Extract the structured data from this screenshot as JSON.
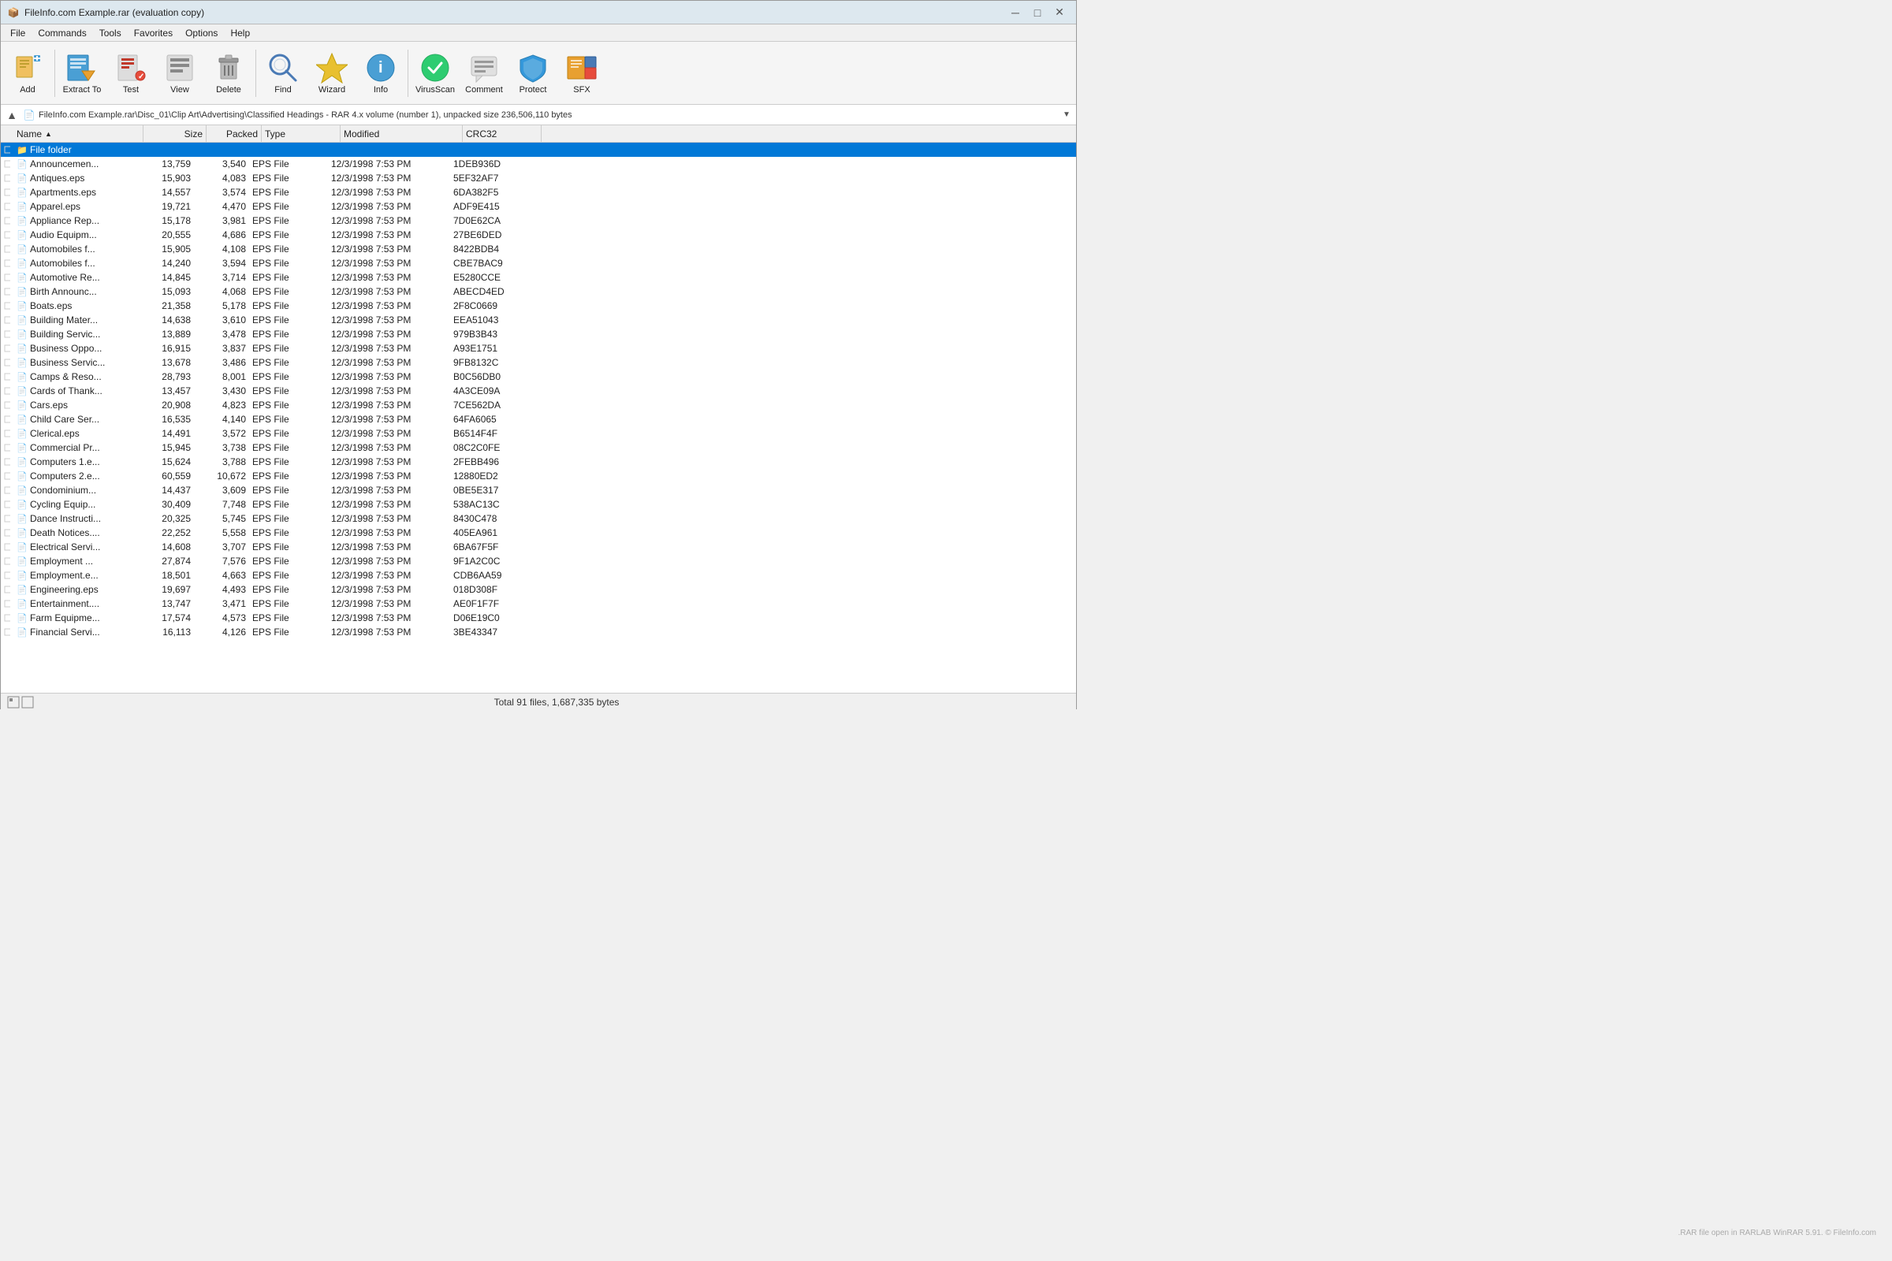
{
  "titleBar": {
    "icon": "📦",
    "title": "FileInfo.com Example.rar (evaluation copy)",
    "minBtn": "─",
    "maxBtn": "□",
    "closeBtn": "✕"
  },
  "menuBar": {
    "items": [
      "File",
      "Commands",
      "Tools",
      "Favorites",
      "Options",
      "Help"
    ]
  },
  "toolbar": {
    "buttons": [
      {
        "id": "add",
        "label": "Add",
        "icon": "add"
      },
      {
        "id": "extract-to",
        "label": "Extract To",
        "icon": "extract"
      },
      {
        "id": "test",
        "label": "Test",
        "icon": "test"
      },
      {
        "id": "view",
        "label": "View",
        "icon": "view"
      },
      {
        "id": "delete",
        "label": "Delete",
        "icon": "delete"
      },
      {
        "id": "find",
        "label": "Find",
        "icon": "find"
      },
      {
        "id": "wizard",
        "label": "Wizard",
        "icon": "wizard"
      },
      {
        "id": "info",
        "label": "Info",
        "icon": "info"
      },
      {
        "id": "virusscan",
        "label": "VirusScan",
        "icon": "virusscan"
      },
      {
        "id": "comment",
        "label": "Comment",
        "icon": "comment"
      },
      {
        "id": "protect",
        "label": "Protect",
        "icon": "protect"
      },
      {
        "id": "sfx",
        "label": "SFX",
        "icon": "sfx"
      }
    ]
  },
  "addressBar": {
    "path": "FileInfo.com Example.rar\\Disc_01\\Clip Art\\Advertising\\Classified Headings - RAR 4.x volume (number 1), unpacked size 236,506,110 bytes"
  },
  "columns": [
    {
      "id": "name",
      "label": "Name",
      "sortArrow": "▲"
    },
    {
      "id": "size",
      "label": "Size"
    },
    {
      "id": "packed",
      "label": "Packed"
    },
    {
      "id": "type",
      "label": "Type"
    },
    {
      "id": "modified",
      "label": "Modified"
    },
    {
      "id": "crc",
      "label": "CRC32"
    }
  ],
  "folderRow": {
    "name": "File folder",
    "selected": true
  },
  "files": [
    {
      "name": "Announcemen...",
      "size": "13,759",
      "packed": "3,540",
      "type": "EPS File",
      "modified": "12/3/1998 7:53 PM",
      "crc": "1DEB936D"
    },
    {
      "name": "Antiques.eps",
      "size": "15,903",
      "packed": "4,083",
      "type": "EPS File",
      "modified": "12/3/1998 7:53 PM",
      "crc": "5EF32AF7"
    },
    {
      "name": "Apartments.eps",
      "size": "14,557",
      "packed": "3,574",
      "type": "EPS File",
      "modified": "12/3/1998 7:53 PM",
      "crc": "6DA382F5"
    },
    {
      "name": "Apparel.eps",
      "size": "19,721",
      "packed": "4,470",
      "type": "EPS File",
      "modified": "12/3/1998 7:53 PM",
      "crc": "ADF9E415"
    },
    {
      "name": "Appliance Rep...",
      "size": "15,178",
      "packed": "3,981",
      "type": "EPS File",
      "modified": "12/3/1998 7:53 PM",
      "crc": "7D0E62CA"
    },
    {
      "name": "Audio Equipm...",
      "size": "20,555",
      "packed": "4,686",
      "type": "EPS File",
      "modified": "12/3/1998 7:53 PM",
      "crc": "27BE6DED"
    },
    {
      "name": "Automobiles f...",
      "size": "15,905",
      "packed": "4,108",
      "type": "EPS File",
      "modified": "12/3/1998 7:53 PM",
      "crc": "8422BDB4"
    },
    {
      "name": "Automobiles f...",
      "size": "14,240",
      "packed": "3,594",
      "type": "EPS File",
      "modified": "12/3/1998 7:53 PM",
      "crc": "CBE7BAC9"
    },
    {
      "name": "Automotive Re...",
      "size": "14,845",
      "packed": "3,714",
      "type": "EPS File",
      "modified": "12/3/1998 7:53 PM",
      "crc": "E5280CCE"
    },
    {
      "name": "Birth Announc...",
      "size": "15,093",
      "packed": "4,068",
      "type": "EPS File",
      "modified": "12/3/1998 7:53 PM",
      "crc": "ABECD4ED"
    },
    {
      "name": "Boats.eps",
      "size": "21,358",
      "packed": "5,178",
      "type": "EPS File",
      "modified": "12/3/1998 7:53 PM",
      "crc": "2F8C0669"
    },
    {
      "name": "Building Mater...",
      "size": "14,638",
      "packed": "3,610",
      "type": "EPS File",
      "modified": "12/3/1998 7:53 PM",
      "crc": "EEA51043"
    },
    {
      "name": "Building Servic...",
      "size": "13,889",
      "packed": "3,478",
      "type": "EPS File",
      "modified": "12/3/1998 7:53 PM",
      "crc": "979B3B43"
    },
    {
      "name": "Business Oppo...",
      "size": "16,915",
      "packed": "3,837",
      "type": "EPS File",
      "modified": "12/3/1998 7:53 PM",
      "crc": "A93E1751"
    },
    {
      "name": "Business Servic...",
      "size": "13,678",
      "packed": "3,486",
      "type": "EPS File",
      "modified": "12/3/1998 7:53 PM",
      "crc": "9FB8132C"
    },
    {
      "name": "Camps & Reso...",
      "size": "28,793",
      "packed": "8,001",
      "type": "EPS File",
      "modified": "12/3/1998 7:53 PM",
      "crc": "B0C56DB0"
    },
    {
      "name": "Cards of Thank...",
      "size": "13,457",
      "packed": "3,430",
      "type": "EPS File",
      "modified": "12/3/1998 7:53 PM",
      "crc": "4A3CE09A"
    },
    {
      "name": "Cars.eps",
      "size": "20,908",
      "packed": "4,823",
      "type": "EPS File",
      "modified": "12/3/1998 7:53 PM",
      "crc": "7CE562DA"
    },
    {
      "name": "Child Care Ser...",
      "size": "16,535",
      "packed": "4,140",
      "type": "EPS File",
      "modified": "12/3/1998 7:53 PM",
      "crc": "64FA6065"
    },
    {
      "name": "Clerical.eps",
      "size": "14,491",
      "packed": "3,572",
      "type": "EPS File",
      "modified": "12/3/1998 7:53 PM",
      "crc": "B6514F4F"
    },
    {
      "name": "Commercial Pr...",
      "size": "15,945",
      "packed": "3,738",
      "type": "EPS File",
      "modified": "12/3/1998 7:53 PM",
      "crc": "08C2C0FE"
    },
    {
      "name": "Computers 1.e...",
      "size": "15,624",
      "packed": "3,788",
      "type": "EPS File",
      "modified": "12/3/1998 7:53 PM",
      "crc": "2FEBB496"
    },
    {
      "name": "Computers 2.e...",
      "size": "60,559",
      "packed": "10,672",
      "type": "EPS File",
      "modified": "12/3/1998 7:53 PM",
      "crc": "12880ED2"
    },
    {
      "name": "Condominium...",
      "size": "14,437",
      "packed": "3,609",
      "type": "EPS File",
      "modified": "12/3/1998 7:53 PM",
      "crc": "0BE5E317"
    },
    {
      "name": "Cycling Equip...",
      "size": "30,409",
      "packed": "7,748",
      "type": "EPS File",
      "modified": "12/3/1998 7:53 PM",
      "crc": "538AC13C"
    },
    {
      "name": "Dance Instructi...",
      "size": "20,325",
      "packed": "5,745",
      "type": "EPS File",
      "modified": "12/3/1998 7:53 PM",
      "crc": "8430C478"
    },
    {
      "name": "Death Notices....",
      "size": "22,252",
      "packed": "5,558",
      "type": "EPS File",
      "modified": "12/3/1998 7:53 PM",
      "crc": "405EA961"
    },
    {
      "name": "Electrical Servi...",
      "size": "14,608",
      "packed": "3,707",
      "type": "EPS File",
      "modified": "12/3/1998 7:53 PM",
      "crc": "6BA67F5F"
    },
    {
      "name": "Employment ...",
      "size": "27,874",
      "packed": "7,576",
      "type": "EPS File",
      "modified": "12/3/1998 7:53 PM",
      "crc": "9F1A2C0C"
    },
    {
      "name": "Employment.e...",
      "size": "18,501",
      "packed": "4,663",
      "type": "EPS File",
      "modified": "12/3/1998 7:53 PM",
      "crc": "CDB6AA59"
    },
    {
      "name": "Engineering.eps",
      "size": "19,697",
      "packed": "4,493",
      "type": "EPS File",
      "modified": "12/3/1998 7:53 PM",
      "crc": "018D308F"
    },
    {
      "name": "Entertainment....",
      "size": "13,747",
      "packed": "3,471",
      "type": "EPS File",
      "modified": "12/3/1998 7:53 PM",
      "crc": "AE0F1F7F"
    },
    {
      "name": "Farm Equipme...",
      "size": "17,574",
      "packed": "4,573",
      "type": "EPS File",
      "modified": "12/3/1998 7:53 PM",
      "crc": "D06E19C0"
    },
    {
      "name": "Financial Servi...",
      "size": "16,113",
      "packed": "4,126",
      "type": "EPS File",
      "modified": "12/3/1998 7:53 PM",
      "crc": "3BE43347"
    }
  ],
  "statusBar": {
    "text": "Total 91 files, 1,687,335 bytes"
  },
  "watermark": ".RAR file open in RARLAB WinRAR 5.91. © FileInfo.com"
}
